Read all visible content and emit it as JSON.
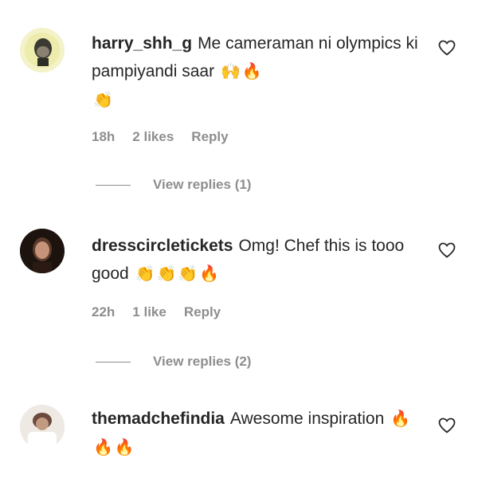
{
  "comments": [
    {
      "username": "harry_shh_g",
      "text": "Me cameraman ni olympics ki pampiyandi saar",
      "emojis": [
        "🙌",
        "🔥",
        "👏"
      ],
      "time": "18h",
      "likes": "2 likes",
      "reply": "Reply",
      "view_replies": "View replies (1)"
    },
    {
      "username": "dresscircletickets",
      "text": "Omg! Chef this is tooo good",
      "emojis": [
        "👏",
        "👏",
        "👏",
        "🔥"
      ],
      "time": "22h",
      "likes": "1 like",
      "reply": "Reply",
      "view_replies": "View replies (2)"
    },
    {
      "username": "themadchefindia",
      "text": "Awesome inspiration",
      "emojis": [
        "🔥",
        "🔥",
        "🔥"
      ]
    }
  ],
  "icons": {
    "like": "heart-outline-icon"
  },
  "colors": {
    "text": "#262626",
    "secondary": "#8e8e8e",
    "background": "#ffffff"
  }
}
